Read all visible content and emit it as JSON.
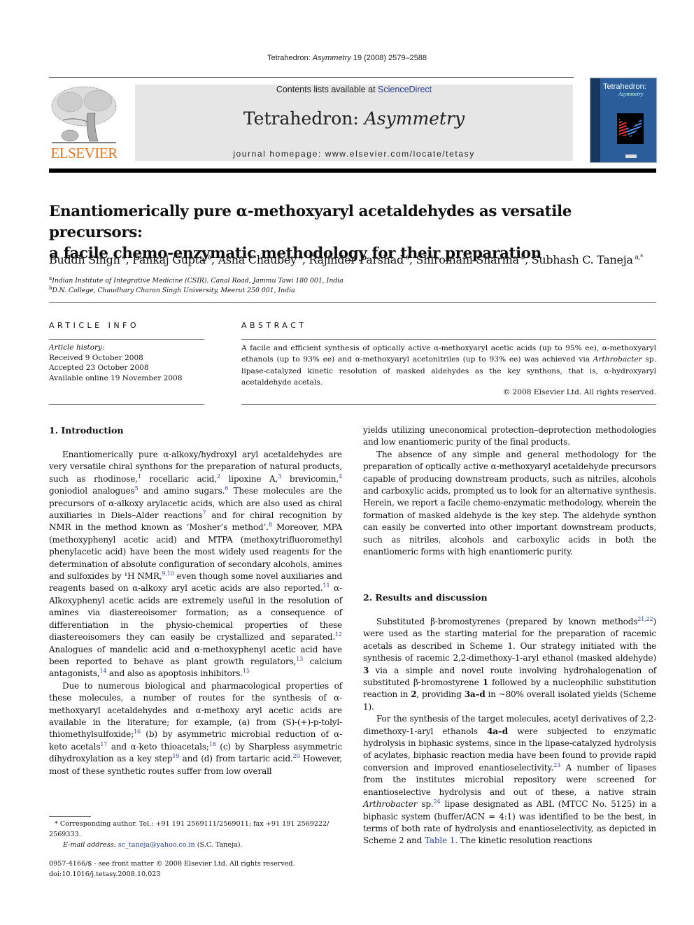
{
  "running_head": {
    "journal_plain": "Tetrahedron: ",
    "journal_italic": "Asymmetry",
    "citation": " 19 (2008) 2579–2588"
  },
  "masthead": {
    "publisher_logo_text": "ELSEVIER",
    "contents_prefix": "Contents lists available at ",
    "contents_link": "ScienceDirect",
    "journal_title_plain": "Tetrahedron: ",
    "journal_title_italic": "Asymmetry",
    "homepage": "journal homepage: www.elsevier.com/locate/tetasy",
    "cover_title": "Tetrahedron:",
    "cover_subtitle": "Asymmetry"
  },
  "article": {
    "title_line1": "Enantiomerically pure α-methoxyaryl acetaldehydes as versatile precursors:",
    "title_line2": "a facile chemo-enzymatic methodology for their preparation",
    "authors": [
      {
        "name": "Buddh Singh",
        "sup": "a",
        "sep": ", "
      },
      {
        "name": "Pankaj Gupta",
        "sup": "a",
        "sep": ", "
      },
      {
        "name": "Asha Chaubey",
        "sup": "a",
        "sep": ", "
      },
      {
        "name": "Rajinder Parshad",
        "sup": "a",
        "sep": ", "
      },
      {
        "name": "Shiromani Sharma",
        "sup": "b",
        "sep": ", "
      },
      {
        "name": "Subhash C. Taneja",
        "sup": "a,*",
        "sep": ""
      }
    ],
    "affiliations": [
      {
        "sup": "a",
        "text": "Indian Institute of Integrative Medicine (CSIR), Canal Road, Jammu Tawi 180 001, India"
      },
      {
        "sup": "b",
        "text": "D.N. College, Chaudhary Charan Singh University, Meerut 250 001, India"
      }
    ]
  },
  "article_info": {
    "heading": "ARTICLE INFO",
    "history_label": "Article history:",
    "received": "Received 9 October 2008",
    "accepted": "Accepted 23 October 2008",
    "online": "Available online 19 November 2008"
  },
  "abstract": {
    "heading": "ABSTRACT",
    "text_part1": "A facile and efficient synthesis of optically active α-methoxyaryl acetic acids (up to 95% ee), α-methoxyaryl ethanols (up to 93% ee) and α-methoxyaryl acetonitriles (up to 93% ee) was achieved via ",
    "text_italic": "Arthrobacter",
    "text_part2": " sp. lipase-catalyzed kinetic resolution of masked aldehydes as the key synthons, that is, α-hydroxyaryl acetaldehyde acetals.",
    "copyright": "© 2008 Elsevier Ltd. All rights reserved."
  },
  "sections": {
    "intro_heading": "1.  Introduction",
    "results_heading": "2.  Results and discussion"
  },
  "intro": {
    "p1": [
      "Enantiomerically pure α-alkoxy/hydroxyl aryl acetaldehydes are very versatile chiral synthons for the preparation of natural products, such as rhodinose,",
      "1",
      " rocellaric acid,",
      "2",
      " lipoxine A,",
      "3",
      " brevicomin,",
      "4",
      " goniodiol analogues",
      "5",
      " and amino sugars.",
      "6",
      " These molecules are the precursors of α-alkoxy arylacetic acids, which are also used as chiral auxiliaries in Diels–Alder reactions",
      "7",
      " and for chiral recognition by NMR in the method known as ‘Mosher’s method’.",
      "8",
      " Moreover, MPA (methoxyphenyl acetic acid) and MTPA (methoxytrifluoromethyl phenylacetic acid) have been the most widely used reagents for the determination of absolute configuration of secondary alcohols, amines and sulfoxides by ¹H NMR,",
      "9,10",
      " even though some novel auxiliaries and reagents based on α-alkoxy aryl acetic acids are also reported.",
      "11",
      " α-Alkoxyphenyl acetic acids are extremely useful in the resolution of amines via diastereoisomer formation; as a consequence of differentiation in the physio-chemical properties of these diastereoisomers they can easily be crystallized and separated.",
      "12",
      " Analogues of mandelic acid and α-methoxyphenyl acetic acid have been reported to behave as plant growth regulators,",
      "13",
      " calcium antagonists,",
      "14",
      " and also as apoptosis inhibitors.",
      "15"
    ],
    "p2": [
      "Due to numerous biological and pharmacological properties of these molecules, a number of routes for the synthesis of α-methoxyaryl acetaldehydes and α-methoxy aryl acetic acids are available in the literature; for example, (a) from (S)-(+)-p-tolyl-thiomethylsulfoxide;",
      "16",
      " (b) by asymmetric microbial reduction of α-keto acetals",
      "17",
      " and α-keto thioacetals;",
      "18",
      " (c) by Sharpless asymmetric dihydroxylation as a key step",
      "19",
      " and (d) from tartaric acid.",
      "20",
      " However, most of these synthetic routes suffer from low overall yields utilizing uneconomical protection–deprotection methodologies and low enantiomeric purity of the final products.",
      ""
    ],
    "p3": "The absence of any simple and general methodology for the preparation of optically active α-methoxyaryl acetaldehyde precursors capable of producing downstream products, such as nitriles, alcohols and carboxylic acids, prompted us to look for an alternative synthesis. Herein, we report a facile chemo-enzymatic methodology, wherein the formation of masked aldehyde is the key step. The aldehyde synthon can easily be converted into other important downstream products, such as nitriles, alcohols and carboxylic acids in both the enantiomeric forms with high enantiomeric purity."
  },
  "results": {
    "p1_a": "Substituted β-bromostyrenes (prepared by known methods",
    "p1_ref": "21,22",
    "p1_b": ") were used as the starting material for the preparation of racemic acetals as described in Scheme 1. Our strategy initiated with the synthesis of racemic 2,2-dimethoxy-1-aryl ethanol (masked aldehyde) ",
    "p1_bold1": "3",
    "p1_c": " via a simple and novel route involving hydrohalogenation of substituted β-bromostyrene ",
    "p1_bold2": "1",
    "p1_d": " followed by a nucleophilic substitution reaction in ",
    "p1_bold3": "2",
    "p1_e": ", providing ",
    "p1_bold4": "3a–d",
    "p1_f": " in ~80% overall isolated yields (Scheme 1).",
    "p2_a": "For the synthesis of the target molecules, acetyl derivatives of 2,2-dimethoxy-1-aryl ethanols ",
    "p2_bold": "4a–d",
    "p2_b": " were subjected to enzymatic hydrolysis in biphasic systems, since in the lipase-catalyzed hydrolysis of acylates, biphasic reaction media have been found to provide rapid conversion and improved enantioselectivity.",
    "p2_ref1": "23",
    "p2_c": " A number of lipases from the institutes microbial repository were screened for enantioselective hydrolysis and out of these, a native strain ",
    "p2_italic": "Arthrobacter",
    "p2_d": " sp.",
    "p2_ref2": "24",
    "p2_e": " lipase designated as ABL (MTCC No. 5125) in a biphasic system (buffer/ACN = 4:1) was identified to be the best, in terms of both rate of hydrolysis and enantioselectivity, as depicted in Scheme 2 and ",
    "p2_link": "Table 1",
    "p2_f": ". The kinetic resolution reactions"
  },
  "footnote": {
    "corresponding": "* Corresponding author. Tel.: +91 191 2569111/2569011; fax +91 191 2569222/ 2569333.",
    "email_label": "E-mail address: ",
    "email": "sc_taneja@yahoo.co.in",
    "email_suffix": " (S.C. Taneja)."
  },
  "front_matter": {
    "issn": "0957-4166/$ - see front matter © 2008 Elsevier Ltd. All rights reserved.",
    "doi": "doi:10.1016/j.tetasy.2008.10.023"
  }
}
